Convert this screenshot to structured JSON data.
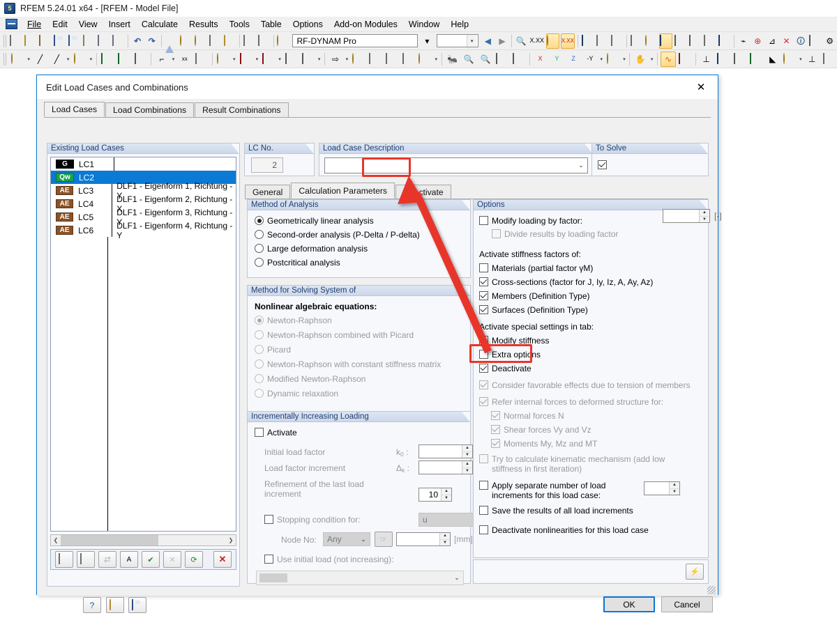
{
  "app": {
    "title": "RFEM 5.24.01 x64 - [RFEM - Model File]",
    "logo_text": "5",
    "menu": [
      "File",
      "Edit",
      "View",
      "Insert",
      "Calculate",
      "Results",
      "Tools",
      "Table",
      "Options",
      "Add-on Modules",
      "Window",
      "Help"
    ],
    "toolbar_combo_value": "RF-DYNAM Pro",
    "toolbar_combo2_value": ""
  },
  "dialog": {
    "title": "Edit Load Cases and Combinations",
    "close_icon": "✕",
    "tabs": [
      {
        "label": "Load Cases",
        "selected": true
      },
      {
        "label": "Load Combinations",
        "selected": false
      },
      {
        "label": "Result Combinations",
        "selected": false
      }
    ],
    "existing_load_cases": {
      "header": "Existing Load Cases",
      "rows": [
        {
          "tag": "G",
          "tag_color": "#000000",
          "no": "LC1",
          "description": "",
          "selected": false
        },
        {
          "tag": "Qw",
          "tag_color": "#1aa34a",
          "no": "LC2",
          "description": "",
          "selected": true
        },
        {
          "tag": "AE",
          "tag_color": "#8a5326",
          "no": "LC3",
          "description": "DLF1 - Eigenform 1, Richtung - Y",
          "selected": false
        },
        {
          "tag": "AE",
          "tag_color": "#8a5326",
          "no": "LC4",
          "description": "DLF1 - Eigenform 2, Richtung - X",
          "selected": false
        },
        {
          "tag": "AE",
          "tag_color": "#8a5326",
          "no": "LC5",
          "description": "DLF1 - Eigenform 3, Richtung - Y",
          "selected": false
        },
        {
          "tag": "AE",
          "tag_color": "#8a5326",
          "no": "LC6",
          "description": "DLF1 - Eigenform 4, Richtung - Y",
          "selected": false
        }
      ],
      "scroll_left_icon": "❮",
      "scroll_right_icon": "❯",
      "toolbar_icons": [
        "new-load-case-icon",
        "copy-load-case-icon",
        "renumber-icon",
        "rename-icon",
        "select-all-icon",
        "deselect-all-icon",
        "refresh-icon",
        "delete-icon"
      ]
    },
    "lc_no": {
      "header": "LC No.",
      "value": "2"
    },
    "lc_description": {
      "header": "Load Case Description",
      "value": "",
      "placeholder": ""
    },
    "to_solve": {
      "header": "To Solve",
      "checked": true
    },
    "inner_tabs": [
      {
        "label": "General",
        "selected": false,
        "highlighted": false
      },
      {
        "label": "Calculation Parameters",
        "selected": true,
        "highlighted": false
      },
      {
        "label": "Deactivate",
        "selected": false,
        "highlighted": true
      }
    ],
    "method_of_analysis": {
      "header": "Method of Analysis",
      "options": [
        {
          "label": "Geometrically linear analysis",
          "selected": true
        },
        {
          "label": "Second-order analysis (P-Delta / P-delta)",
          "selected": false
        },
        {
          "label": "Large deformation analysis",
          "selected": false
        },
        {
          "label": "Postcritical analysis",
          "selected": false
        }
      ]
    },
    "method_for_solving": {
      "header": "Method for Solving System of",
      "subheader": "Nonlinear algebraic equations:",
      "options": [
        {
          "label": "Newton-Raphson",
          "selected": true,
          "disabled": true
        },
        {
          "label": "Newton-Raphson combined with Picard",
          "selected": false,
          "disabled": true
        },
        {
          "label": "Picard",
          "selected": false,
          "disabled": true
        },
        {
          "label": "Newton-Raphson with constant stiffness matrix",
          "selected": false,
          "disabled": true
        },
        {
          "label": "Modified Newton-Raphson",
          "selected": false,
          "disabled": true
        },
        {
          "label": "Dynamic relaxation",
          "selected": false,
          "disabled": true
        }
      ]
    },
    "incrementally_increasing_loading": {
      "header": "Incrementally Increasing Loading",
      "activate": {
        "label": "Activate",
        "checked": false
      },
      "initial_load_factor": {
        "label": "Initial load factor",
        "symbol": "k0",
        "value": "",
        "unit": "[-]"
      },
      "load_factor_increment": {
        "label": "Load factor increment",
        "symbol": "Δk",
        "value": "",
        "unit": "[-]"
      },
      "refinement": {
        "label": "Refinement of the last load increment",
        "value": "10"
      },
      "stopping_condition": {
        "label": "Stopping condition for:",
        "checked": false,
        "select_value": "u"
      },
      "node_no": {
        "label": "Node No:",
        "select_value": "Any",
        "value": "",
        "unit": "[mm]",
        "pick_icon": "pick-node-icon"
      },
      "use_initial_load": {
        "label": "Use initial load (not increasing):",
        "checked": false,
        "select_value": ""
      }
    },
    "options": {
      "header": "Options",
      "modify_loading": {
        "label": "Modify loading by factor:",
        "underline_char": "f",
        "checked": false,
        "value": "",
        "unit": "[-]"
      },
      "divide_results": {
        "label": "Divide results by loading factor",
        "checked": false,
        "disabled": true
      },
      "activate_stiffness_label": "Activate stiffness factors of:",
      "stiffness_items": [
        {
          "label": "Materials (partial factor γM)",
          "checked": false,
          "disabled": false
        },
        {
          "label": "Cross-sections (factor for J, Iy, Iz, A, Ay, Az)",
          "checked": true,
          "disabled": false
        },
        {
          "label": "Members (Definition Type)",
          "checked": true,
          "disabled": false
        },
        {
          "label": "Surfaces (Definition Type)",
          "checked": true,
          "disabled": false
        }
      ],
      "activate_special_label": "Activate special settings in tab:",
      "special_items": [
        {
          "label": "Modify stiffness",
          "checked": false,
          "highlighted": false
        },
        {
          "label": "Extra options",
          "checked": false,
          "highlighted": false
        },
        {
          "label": "Deactivate",
          "checked": true,
          "highlighted": true
        }
      ],
      "consider_favorable": {
        "label": "Consider favorable effects due to tension of members",
        "checked": true,
        "disabled": true
      },
      "refer_internal": {
        "label": "Refer internal forces to deformed structure for:",
        "checked": true,
        "disabled": true
      },
      "refer_sub_items": [
        {
          "label": "Normal forces N",
          "checked": true,
          "disabled": true
        },
        {
          "label": "Shear forces Vy and Vz",
          "checked": true,
          "disabled": true
        },
        {
          "label": "Moments My, Mz and MT",
          "checked": true,
          "disabled": true
        }
      ],
      "kinematic": {
        "label": "Try to calculate kinematic mechanism (add low stiffness in first iteration)",
        "checked": false,
        "disabled": true
      },
      "apply_separate": {
        "label": "Apply separate number of load increments for this load case:",
        "checked": false,
        "value": ""
      },
      "save_results": {
        "label": "Save the results of all load increments",
        "checked": false
      },
      "deactivate_nonlinearities": {
        "label": "Deactivate nonlinearities for this load case",
        "checked": false
      },
      "settings_icon": "calc-settings-icon"
    },
    "footer": {
      "help_icon": "help-icon",
      "open_icon": "open-icon",
      "save_icon": "save-icon",
      "ok_label": "OK",
      "cancel_label": "Cancel"
    }
  },
  "annotation": {
    "arrow_color": "#e8362a",
    "from": "deactivate-checkbox",
    "to": "deactivate-tab"
  }
}
